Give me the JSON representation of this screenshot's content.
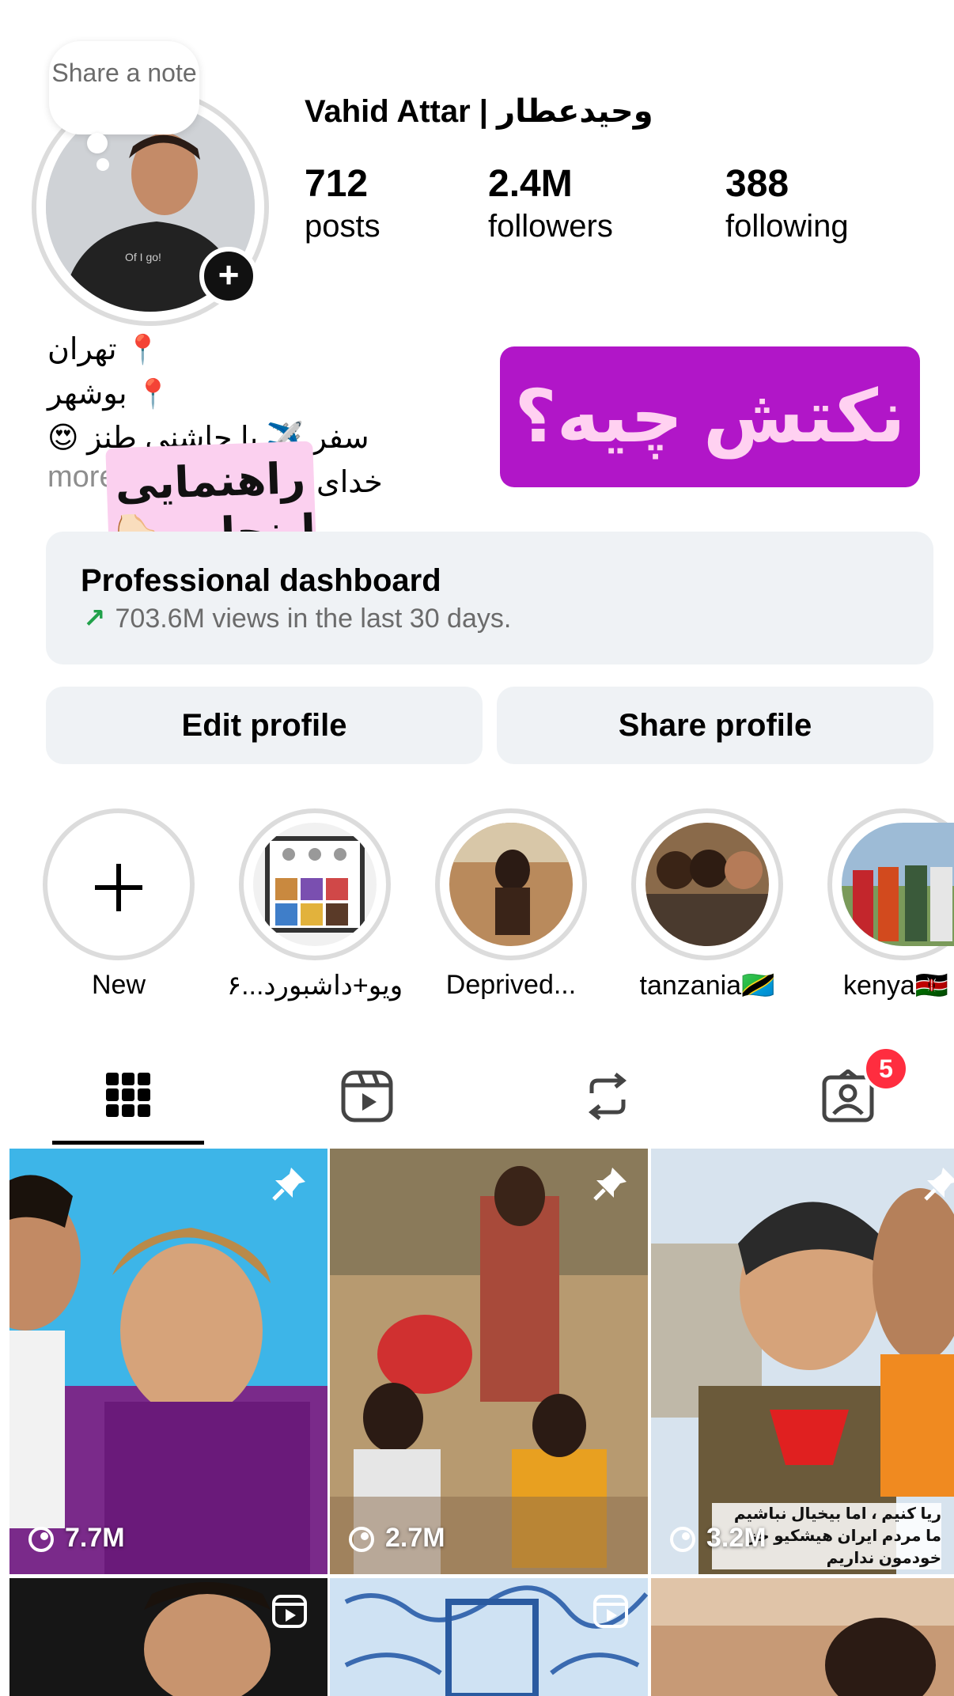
{
  "profile": {
    "note_text": "Share a note",
    "username": "Vahid Attar | وحیدعطار",
    "stats": [
      {
        "num": "712",
        "label": "posts"
      },
      {
        "num": "2.4M",
        "label": "followers"
      },
      {
        "num": "388",
        "label": "following"
      }
    ],
    "bio_lines": [
      "تهران",
      "بوشهر",
      "سفر ✈️ با چاشنی طنز 😍",
      "خدای"
    ],
    "more": "more"
  },
  "overlay": {
    "purple_text": "نکتش چیه؟",
    "pink_text_1": "راهنمایی",
    "pink_text_2": "اینجاس👇🏻"
  },
  "dashboard": {
    "title": "Professional dashboard",
    "subtitle": "703.6M views in the last 30 days."
  },
  "actions": {
    "edit": "Edit profile",
    "share": "Share profile"
  },
  "highlights": [
    {
      "label": "New"
    },
    {
      "label": "ویو+داشبورد...۶"
    },
    {
      "label": "Deprived..."
    },
    {
      "label": "tanzania🇹🇿"
    },
    {
      "label": "kenya🇰🇪"
    }
  ],
  "tabs": {
    "tagged_badge": "5"
  },
  "grid": [
    {
      "views": "7.7M",
      "pinned": true
    },
    {
      "views": "2.7M",
      "pinned": true
    },
    {
      "views": "3.2M",
      "pinned": true,
      "caption_1": "ریا کنیم ، اما بیخیال نباشیم",
      "caption_2": "ما مردم ایران هیشکیو جز خودمون نداریم"
    }
  ],
  "colors": {
    "purple": "#b116c8",
    "pink": "#fbd0ef",
    "badge": "#ff2d3f",
    "trend": "#21a14a"
  }
}
